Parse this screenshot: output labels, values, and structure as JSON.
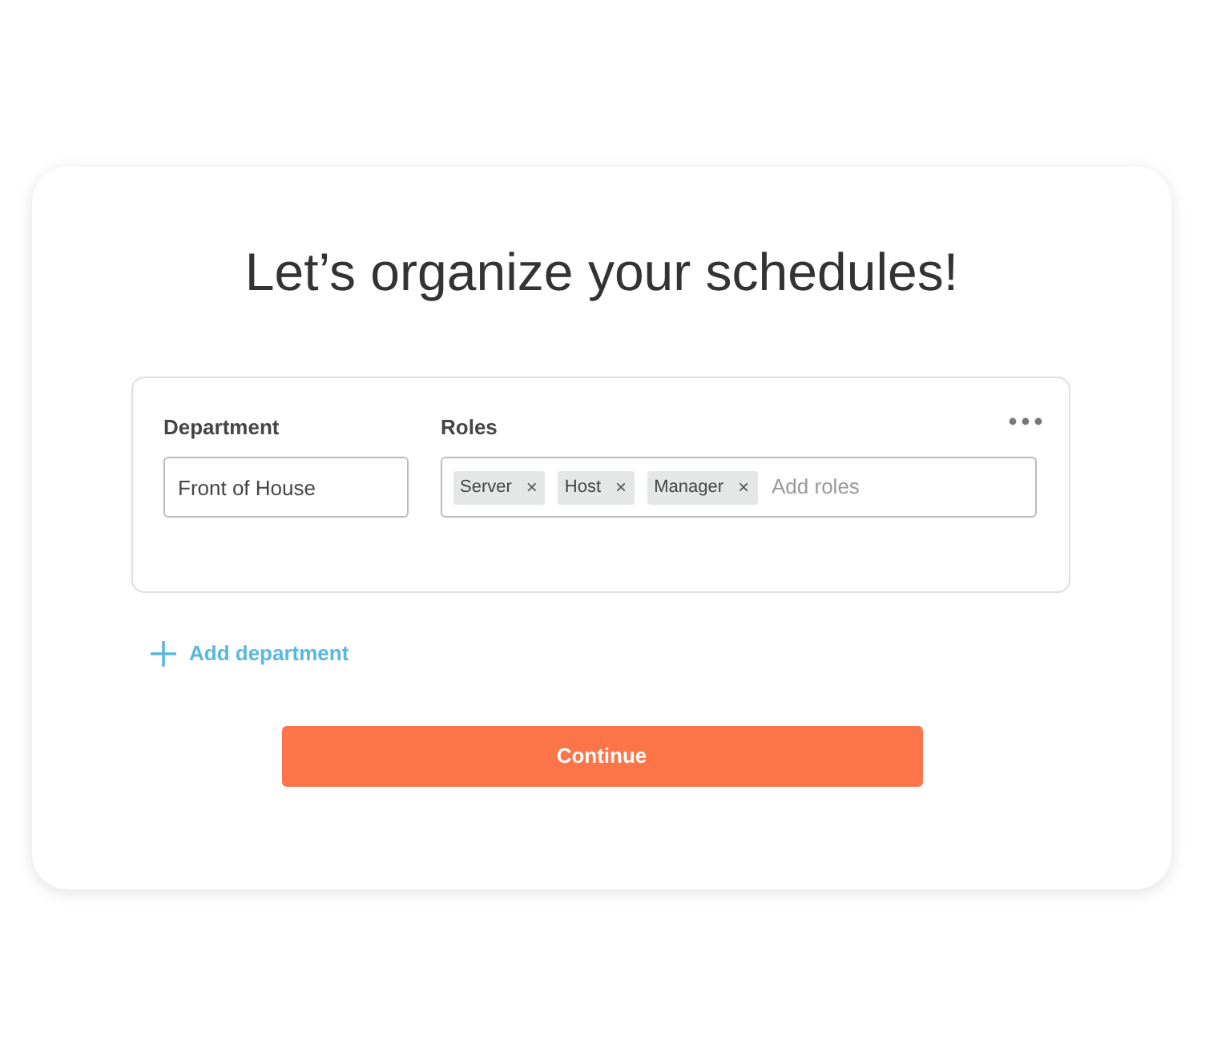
{
  "title": "Let’s organize your schedules!",
  "department_card": {
    "department_label": "Department",
    "department_value": "Front of House",
    "roles_label": "Roles",
    "roles": [
      {
        "label": "Server",
        "remove": "×"
      },
      {
        "label": "Host",
        "remove": "×"
      },
      {
        "label": "Manager",
        "remove": "×"
      }
    ],
    "roles_placeholder": "Add roles"
  },
  "add_department": "Add department",
  "continue_button": "Continue"
}
